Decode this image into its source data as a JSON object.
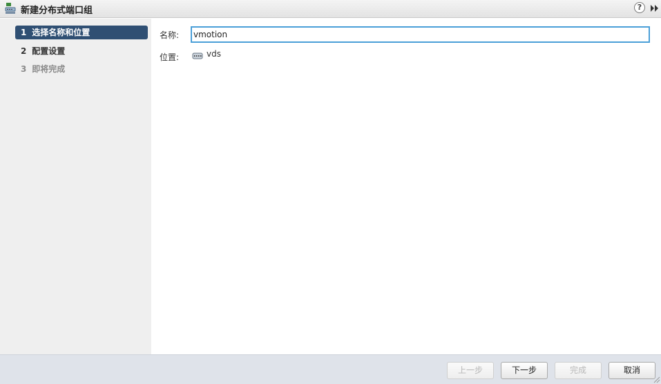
{
  "window": {
    "title": "新建分布式端口组",
    "help_label": "?"
  },
  "sidebar": {
    "steps": [
      {
        "number": "1",
        "label": "选择名称和位置",
        "state": "active"
      },
      {
        "number": "2",
        "label": "配置设置",
        "state": "normal"
      },
      {
        "number": "3",
        "label": "即将完成",
        "state": "disabled"
      }
    ]
  },
  "form": {
    "name_label": "名称:",
    "name_value": "vmotion",
    "location_label": "位置:",
    "location_value": "vds"
  },
  "footer": {
    "back_label": "上一步",
    "next_label": "下一步",
    "finish_label": "完成",
    "cancel_label": "取消"
  },
  "colors": {
    "active_step_bg": "#2f4f73",
    "input_focus_border": "#4a9fd8",
    "sidebar_bg": "#efefef",
    "footer_bg": "#dfe3ea"
  },
  "icons": {
    "title": "distributed-port-group-icon",
    "help": "help-icon",
    "expand": "double-chevron-right-icon",
    "location": "distributed-switch-icon",
    "resize": "resize-grip-icon"
  }
}
